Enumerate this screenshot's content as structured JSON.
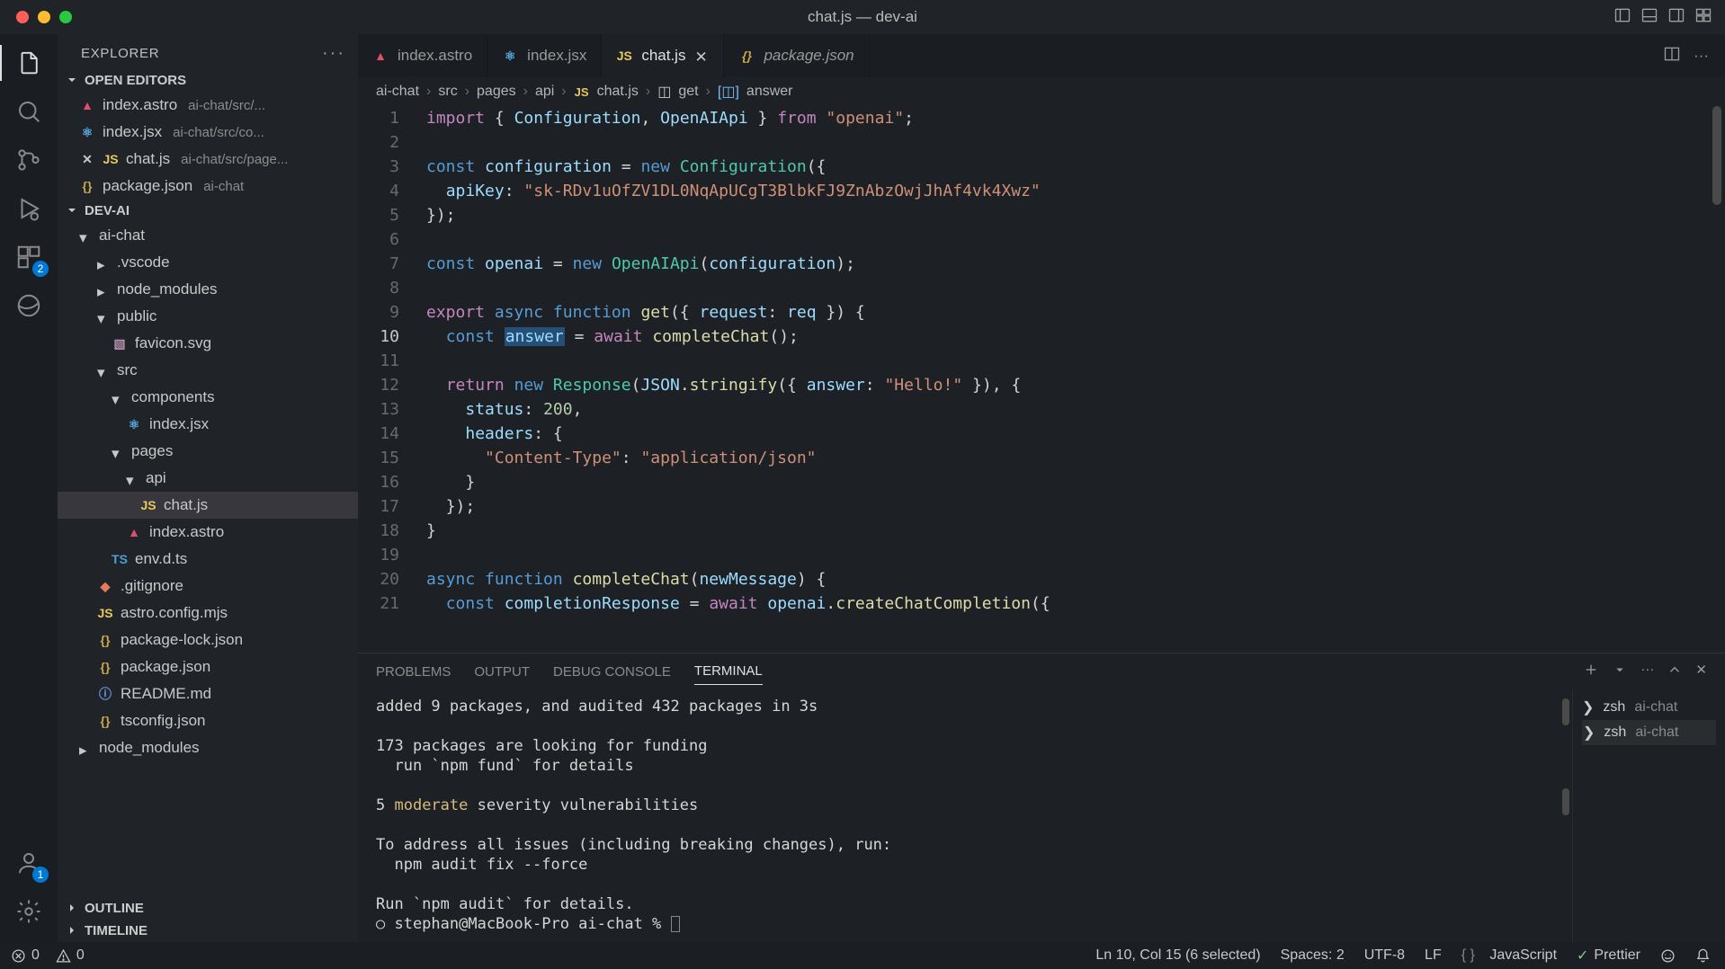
{
  "window": {
    "title": "chat.js — dev-ai"
  },
  "activity": {
    "ext_badge": "2",
    "account_badge": "1"
  },
  "sidebar": {
    "title": "EXPLORER",
    "sections": {
      "openEditors": {
        "label": "OPEN EDITORS",
        "items": [
          {
            "name": "index.astro",
            "desc": "ai-chat/src/..."
          },
          {
            "name": "index.jsx",
            "desc": "ai-chat/src/co..."
          },
          {
            "name": "chat.js",
            "desc": "ai-chat/src/page..."
          },
          {
            "name": "package.json",
            "desc": "ai-chat"
          }
        ]
      },
      "workspace": {
        "label": "DEV-AI",
        "tree": {
          "ai_chat": "ai-chat",
          "vscode": ".vscode",
          "node_modules": "node_modules",
          "public": "public",
          "favicon": "favicon.svg",
          "src": "src",
          "components": "components",
          "index_jsx": "index.jsx",
          "pages": "pages",
          "api": "api",
          "chat_js": "chat.js",
          "index_astro": "index.astro",
          "env_d_ts": "env.d.ts",
          "gitignore": ".gitignore",
          "astro_config": "astro.config.mjs",
          "pkg_lock": "package-lock.json",
          "pkg_json": "package.json",
          "readme": "README.md",
          "tsconfig": "tsconfig.json",
          "root_nm": "node_modules"
        }
      },
      "outline": "OUTLINE",
      "timeline": "TIMELINE"
    }
  },
  "tabs": [
    {
      "name": "index.astro",
      "icon": "astro",
      "active": false,
      "italic": false
    },
    {
      "name": "index.jsx",
      "icon": "react",
      "active": false,
      "italic": false
    },
    {
      "name": "chat.js",
      "icon": "js",
      "active": true,
      "italic": false
    },
    {
      "name": "package.json",
      "icon": "json",
      "active": false,
      "italic": true
    }
  ],
  "breadcrumbs": [
    "ai-chat",
    "src",
    "pages",
    "api",
    "chat.js",
    "get",
    "answer"
  ],
  "code": {
    "lines_start": 1,
    "lines_end": 21,
    "cursor_line": 10,
    "content": [
      "import { Configuration, OpenAIApi } from \"openai\";",
      "",
      "const configuration = new Configuration({",
      "  apiKey: \"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\"",
      "});",
      "",
      "const openai = new OpenAIApi(configuration);",
      "",
      "export async function get({ request: req }) {",
      "  const answer = await completeChat();",
      "",
      "  return new Response(JSON.stringify({ answer: \"Hello!\" }), {",
      "    status: 200,",
      "    headers: {",
      "      \"Content-Type\": \"application/json\"",
      "    }",
      "  });",
      "}",
      "",
      "async function completeChat(newMessage) {",
      "  const completionResponse = await openai.createChatCompletion({"
    ]
  },
  "panel": {
    "tabs": [
      "PROBLEMS",
      "OUTPUT",
      "DEBUG CONSOLE",
      "TERMINAL"
    ],
    "active": "TERMINAL",
    "terminals": [
      {
        "shell": "zsh",
        "cwd": "ai-chat"
      },
      {
        "shell": "zsh",
        "cwd": "ai-chat"
      }
    ],
    "output": [
      "added 9 packages, and audited 432 packages in 3s",
      "",
      "173 packages are looking for funding",
      "  run `npm fund` for details",
      "",
      "5 moderate severity vulnerabilities",
      "",
      "To address all issues (including breaking changes), run:",
      "  npm audit fix --force",
      "",
      "Run `npm audit` for details.",
      "○ stephan@MacBook-Pro ai-chat % "
    ]
  },
  "status": {
    "errors": "0",
    "warnings": "0",
    "cursor": "Ln 10, Col 15 (6 selected)",
    "spaces": "Spaces: 2",
    "encoding": "UTF-8",
    "eol": "LF",
    "lang": "JavaScript",
    "prettier": "Prettier"
  }
}
